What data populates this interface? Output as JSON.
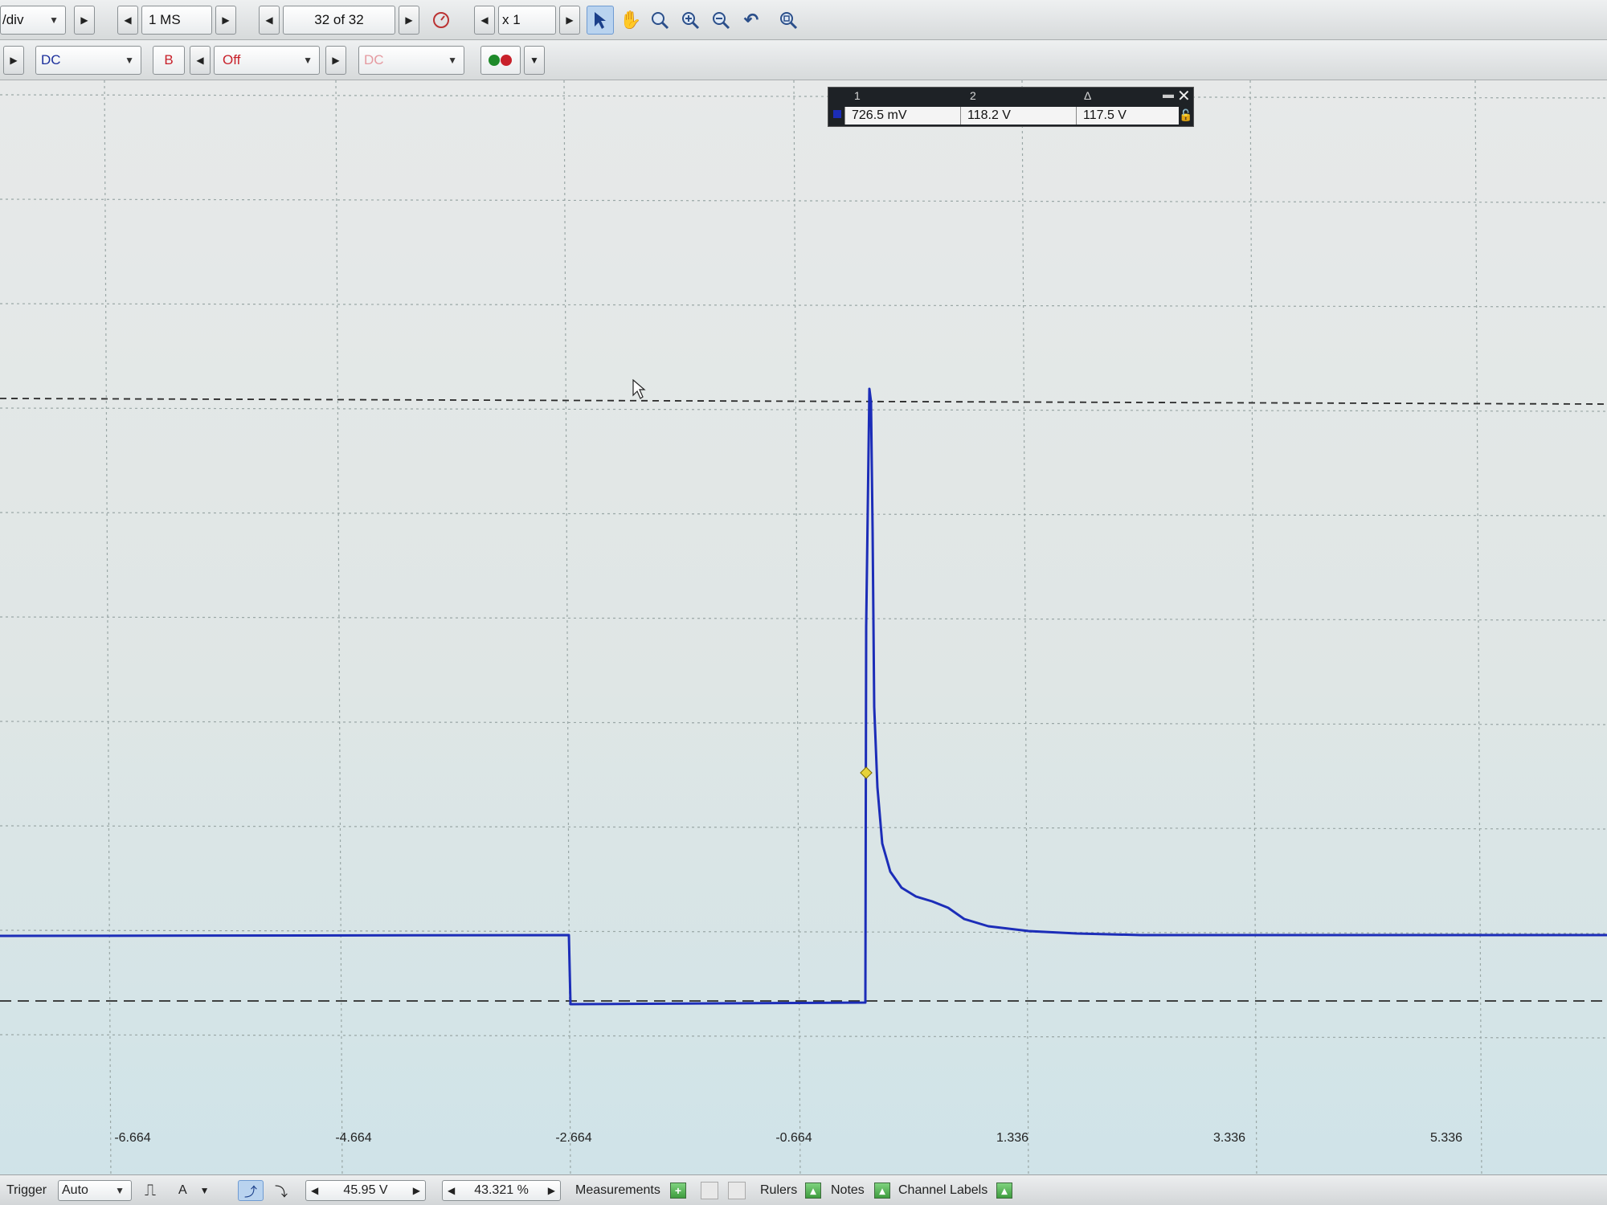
{
  "toolbar1": {
    "timebase_label": "/div",
    "samples_label": "1 MS",
    "capture_label": "32 of 32",
    "zoom_factor_label": "x 1"
  },
  "toolbar2": {
    "channel_a_coupling": "DC",
    "channel_b_label": "B",
    "channel_b_range": "Off",
    "channel_b_coupling": "DC"
  },
  "rulers_panel": {
    "col1_header": "1",
    "col2_header": "2",
    "col3_header": "Δ",
    "ruler1_value": "726.5 mV",
    "ruler2_value": "118.2 V",
    "delta_value": "117.5 V"
  },
  "x_axis": {
    "ticks": [
      "-6.664",
      "-4.664",
      "-2.664",
      "-0.664",
      "1.336",
      "3.336",
      "5.336"
    ]
  },
  "statusbar": {
    "trigger_label": "Trigger",
    "trigger_mode": "Auto",
    "trigger_channel": "A",
    "threshold": "45.95 V",
    "pre_trigger": "43.321 %",
    "measurements_label": "Measurements",
    "rulers_label": "Rulers",
    "notes_label": "Notes",
    "channel_labels_label": "Channel Labels"
  },
  "colors": {
    "trace": "#1c2db8",
    "trigger_marker": "#e6d23a"
  },
  "icons": [
    "pointer-icon",
    "hand-pan-icon",
    "zoom-icon",
    "zoom-in-icon",
    "zoom-out-icon",
    "undo-zoom-icon",
    "zoom-fit-icon",
    "stopwatch-icon",
    "close-icon",
    "lock-icon"
  ]
}
